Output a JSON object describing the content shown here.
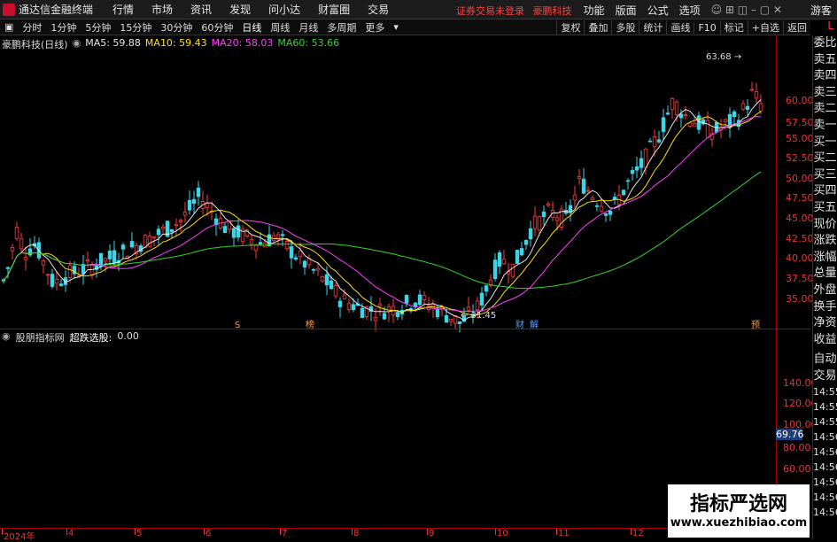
{
  "topbar": {
    "app_name": "通达信金融终端",
    "menus": [
      "行情",
      "市场",
      "资讯",
      "发现",
      "问小达",
      "财富圈",
      "交易"
    ],
    "notice_a": "证券交易未登录",
    "notice_b": "豪鹏科技",
    "right_tools": [
      "功能",
      "版面",
      "公式",
      "选项"
    ],
    "guest": "游客"
  },
  "periods": [
    "分时",
    "1分钟",
    "5分钟",
    "15分钟",
    "30分钟",
    "60分钟",
    "日线",
    "周线",
    "月线",
    "多周期",
    "更多"
  ],
  "active_period": "日线",
  "chart_buttons": [
    "复权",
    "叠加",
    "多股",
    "统计",
    "画线",
    "F10",
    "标记",
    "+自选",
    "返回"
  ],
  "kline": {
    "title": "豪鹏科技(日线)",
    "ma": [
      {
        "name": "MA5",
        "value": "59.88",
        "color": "#e6e6e6"
      },
      {
        "name": "MA10",
        "value": "59.43",
        "color": "#ffe000"
      },
      {
        "name": "MA20",
        "value": "58.03",
        "color": "#ff40ff"
      },
      {
        "name": "MA60",
        "value": "53.66",
        "color": "#34d62c"
      }
    ],
    "yticks": [
      "60.00",
      "57.50",
      "55.00",
      "52.50",
      "50.00",
      "47.50",
      "45.00",
      "42.50",
      "40.00",
      "37.50",
      "35.00"
    ],
    "high_label": "63.68",
    "low_label": "31.45",
    "events": [
      "S",
      "榜",
      "财",
      "解",
      "预"
    ]
  },
  "indicator": {
    "name": "股朋指标网",
    "label": "超跌选股:",
    "value": "0.00",
    "yticks": [
      "140.00",
      "120.00",
      "100.00",
      "80.00",
      "60.00"
    ],
    "price_tag": "69.76"
  },
  "x_dates": [
    "2024年",
    "4",
    "5",
    "6",
    "7",
    "8",
    "9",
    "10",
    "11",
    "12"
  ],
  "side_panel": {
    "top_mark": "L",
    "labels": [
      "委比",
      "卖五",
      "卖四",
      "卖三",
      "卖二",
      "卖一",
      "买一",
      "买二",
      "买三",
      "买四",
      "买五",
      "现价",
      "涨跌",
      "涨幅",
      "总量",
      "外盘",
      "换手",
      "净资",
      "收益"
    ],
    "auto_trade": [
      "自动",
      "交易"
    ],
    "clock_times": [
      "14:55",
      "14:55",
      "14:55",
      "14:56",
      "14:56",
      "14:56",
      "14:56",
      "14:56",
      "14:56"
    ]
  },
  "watermark": {
    "line1": "指标严选网",
    "line2": "www.xuezhibiao.com"
  }
}
